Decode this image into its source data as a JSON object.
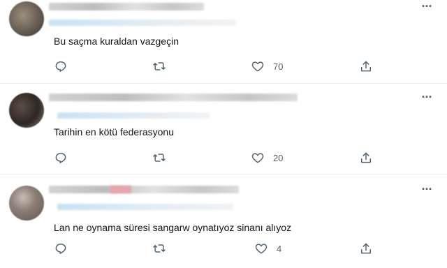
{
  "tweets": [
    {
      "text": "Bu saçma kuraldan vazgeçin",
      "like_count": "70",
      "more_label": "···"
    },
    {
      "text": "Tarihin en kötü federasyonu",
      "like_count": "20",
      "more_label": "···"
    },
    {
      "text": "Lan ne oynama süresi sangarw oynatıyoz sinanı alıyoz",
      "like_count": "4",
      "more_label": "···"
    }
  ],
  "icons": {
    "reply": "reply-icon",
    "retweet": "retweet-icon",
    "like": "like-icon",
    "share": "share-icon",
    "more": "more-icon"
  },
  "colors": {
    "text": "#0f1419",
    "secondary": "#536471",
    "divider": "#e6ecf0"
  }
}
